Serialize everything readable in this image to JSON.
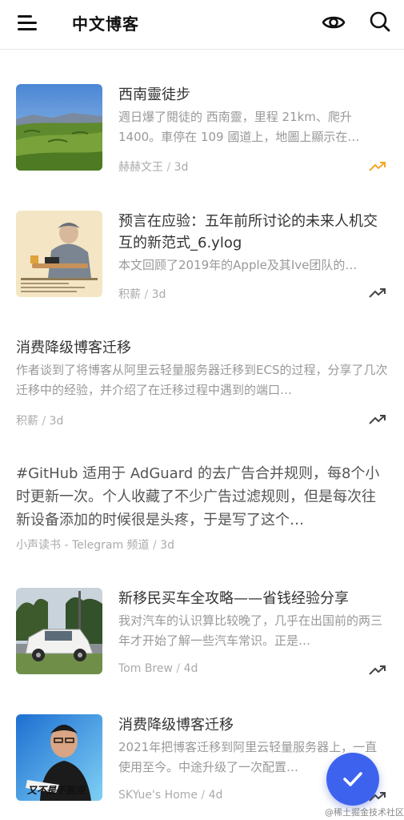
{
  "app": {
    "title": "中文博客",
    "icons": {
      "menu": "menu-icon",
      "eye": "eye-icon",
      "search": "search-icon",
      "trend": "trending-up-icon",
      "fab": "check-icon"
    },
    "colors": {
      "accent": "#3d63ee",
      "trend_hot": "#f5a623",
      "trend_normal": "#444444"
    }
  },
  "posts": [
    {
      "title": "西南靈徒步",
      "excerpt": "週日爆了閱徒的 西南靈，里程 21km、爬升 1400。車停在 109 國道上，地圖上顯示在…",
      "author": "赫赫文王",
      "age": "3d",
      "trend": "hot"
    },
    {
      "title": "预言在应验：五年前所讨论的未来人机交互的新范式_6.ylog",
      "excerpt": "本文回顾了2019年的Apple及其Ive团队的…",
      "author": "积薪",
      "age": "3d",
      "trend": "normal"
    },
    {
      "title": "消费降级博客迁移",
      "excerpt": "作者谈到了将博客从阿里云轻量服务器迁移到ECS的过程，分享了几次迁移中的经验，并介绍了在迁移过程中遇到的端口…",
      "author": "积薪",
      "age": "3d",
      "trend": "normal"
    },
    {
      "title": "",
      "excerpt": "#GitHub 适用于 AdGuard 的去广告合并规则，每8个小时更新一次。个人收藏了不少广告过滤规则，但是每次往新设备添加的时候很是头疼，于是写了这个…",
      "author": "小声读书 - Telegram 频道",
      "age": "3d",
      "trend": "none"
    },
    {
      "title": "新移民买车全攻略——省钱经验分享",
      "excerpt": "我对汽车的认识算比较晚了，几乎在出国前的两三年才开始了解一些汽车常识。正是…",
      "author": "Tom Brew",
      "age": "4d",
      "trend": "normal"
    },
    {
      "title": "消费降级博客迁移",
      "excerpt": "2021年把博客迁移到阿里云轻量服务器上，一直使用至今。中途升级了一次配置…",
      "author": "SKYue's Home",
      "age": "4d",
      "trend": "normal",
      "image_caption": "又不是不能用"
    }
  ],
  "meta_separator": " / ",
  "watermark": "@稀土掘金技术社区"
}
